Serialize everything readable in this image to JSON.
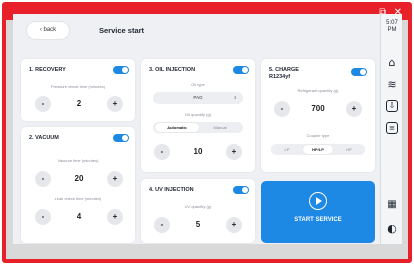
{
  "colors": {
    "accent": "#1e88e5",
    "frame": "#e8202a"
  },
  "window": {
    "titlebar_icons": "⧉ ✕"
  },
  "header": {
    "back_label": "back",
    "title": "Service start"
  },
  "sidebar": {
    "time": "5:07",
    "ampm": "PM",
    "icons": [
      "home-icon",
      "wifi-icon",
      "download-icon",
      "database-icon",
      "qr-icon",
      "contrast-icon"
    ]
  },
  "recovery": {
    "title": "1. RECOVERY",
    "enabled": true,
    "pressure_label": "Pressure check time (minutes)",
    "pressure_value": "2"
  },
  "vacuum": {
    "title": "2. VACUUM",
    "enabled": true,
    "vacuum_label": "Vacuum time (minutes)",
    "vacuum_value": "20",
    "leak_label": "Leak check time (minutes)",
    "leak_value": "4"
  },
  "oil": {
    "title": "3. OIL INJECTION",
    "enabled": true,
    "type_label": "Oil type",
    "type_value": "PAG",
    "qty_label": "Oil quantity (g)",
    "mode_options": [
      "Automatic",
      "Manual"
    ],
    "mode_selected": "Automatic",
    "qty_value": "10"
  },
  "uv": {
    "title": "4. UV INJECTION",
    "enabled": true,
    "qty_label": "UV quantity (g)",
    "qty_value": "5"
  },
  "charge": {
    "title": "5. CHARGE",
    "refrigerant": "R1234yf",
    "enabled": true,
    "qty_label": "Refrigerant quantity (g)",
    "qty_value": "700",
    "coupler_label": "Coupler type",
    "coupler_options": [
      "LP",
      "HP/LP",
      "HP"
    ],
    "coupler_selected": "HP/LP"
  },
  "start": {
    "label": "START SERVICE"
  },
  "controls": {
    "minus": "-",
    "plus": "+"
  }
}
